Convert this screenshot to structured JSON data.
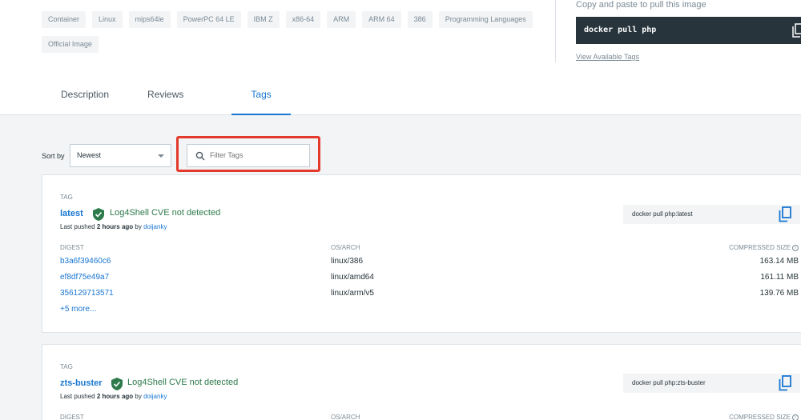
{
  "chips": [
    "Container",
    "Linux",
    "mips64le",
    "PowerPC 64 LE",
    "IBM Z",
    "x86-64",
    "ARM",
    "ARM 64",
    "386",
    "Programming Languages",
    "Official Image"
  ],
  "pull": {
    "hint": "Copy and paste to pull this image",
    "command": "docker pull php",
    "view_tags": "View Available Tags"
  },
  "tabs": {
    "description": "Description",
    "reviews": "Reviews",
    "tags": "Tags"
  },
  "sort": {
    "label": "Sort by",
    "value": "Newest"
  },
  "filter": {
    "placeholder": "Filter Tags"
  },
  "cards": [
    {
      "tag_label": "TAG",
      "name": "latest",
      "log4shell": "Log4Shell CVE not detected",
      "pushed_prefix": "Last pushed",
      "pushed_time": "2 hours ago",
      "pushed_by_word": "by",
      "pushed_by": "doijanky",
      "pull_cmd": "docker pull php:latest",
      "headers": {
        "digest": "DIGEST",
        "os_arch": "OS/ARCH",
        "size": "COMPRESSED SIZE"
      },
      "rows": [
        {
          "digest": "b3a6f39460c6",
          "os": "linux/386",
          "size": "163.14 MB"
        },
        {
          "digest": "ef8df75e49a7",
          "os": "linux/amd64",
          "size": "161.11 MB"
        },
        {
          "digest": "356129713571",
          "os": "linux/arm/v5",
          "size": "139.76 MB"
        }
      ],
      "more": "+5 more..."
    },
    {
      "tag_label": "TAG",
      "name": "zts-buster",
      "log4shell": "Log4Shell CVE not detected",
      "pushed_prefix": "Last pushed",
      "pushed_time": "2 hours ago",
      "pushed_by_word": "by",
      "pushed_by": "doijanky",
      "pull_cmd": "docker pull php:zts-buster",
      "headers": {
        "digest": "DIGEST",
        "os_arch": "OS/ARCH",
        "size": "COMPRESSED SIZE"
      }
    }
  ],
  "colors": {
    "accent": "#1976d2",
    "highlight": "#e33a2b",
    "shield": "#2d7a4b",
    "dark": "#27343b"
  },
  "icons": [
    "copy-icon",
    "search-icon",
    "shield-check-icon",
    "chevron-down-icon",
    "info-icon"
  ]
}
